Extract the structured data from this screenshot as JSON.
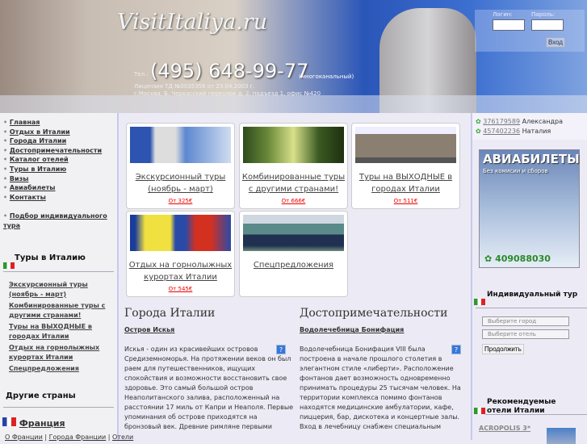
{
  "header": {
    "logo": "VisitItaliya.ru",
    "tel_label": "Тел.:",
    "phone": "(495) 648-99-77",
    "phone_note": "(многоканальный)",
    "license": "Лицензия ТД №0035356 от 23.04.2003 г.",
    "address": "г.Москва, Б. Черкасский переулок д. 2, подъезд 1, офис №420",
    "login_label": "Логин:",
    "password_label": "Пароль:",
    "login_button": "Вход"
  },
  "nav": [
    "Главная",
    "Отдых в Италии",
    "Города Италии",
    "Достопримечательности",
    "Каталог отелей",
    "Туры в Италию",
    "Визы",
    "Авиабилеты",
    "Контакты"
  ],
  "nav_extra": "Подбор индивидуального тура",
  "left": {
    "tours_title": "Туры в Италию",
    "tours": [
      "Экскурсионный туры (ноябрь - март)",
      "Комбинированные туры с другими странами!",
      "Туры на ВЫХОДНЫЕ в городах Италии",
      "Отдых на горнолыжных курортах Италии",
      "Спецпредложения"
    ],
    "other_title": "Другие страны",
    "france": "Франция",
    "france_links": [
      "О Франции",
      "Города Франции",
      "Отели"
    ]
  },
  "cards": [
    {
      "title": "Экскурсионный туры (ноябрь - март)",
      "price": "От 325€"
    },
    {
      "title": "Комбинированные туры с другими странами!",
      "price": "От 666€"
    },
    {
      "title": "Туры на ВЫХОДНЫЕ в городах Италии",
      "price": "От 511€"
    },
    {
      "title": "Отдых на горнолыжных курортах Италии",
      "price": "От 545€"
    },
    {
      "title": "Спецпредложения"
    }
  ],
  "cities": {
    "title": "Города Италии",
    "subtitle": "Остров Искья",
    "text": "Искья - один из красивейших островов Средиземноморья. На протяжении веков он был раем для путешественников, ищущих спокойствия и возможности восстановить свое здоровье. Это самый большой остров Неаполитанского залива, расположенный на расстоянии 17 миль от Капри и Неаполя. Первые упоминания об острове приходятся на бронзовый век. Древние римляне первыми"
  },
  "sights": {
    "title": "Достопримечательности",
    "subtitle": "Водолечебница Бонифация",
    "text": "Водолечебница Бонифация VIII была построена в начале прошлого столетия в элегантном стиле «либерти». Расположение фонтанов дает возможность одновременно принимать процедуры 25 тысячам человек. На территории комплекса помимо фонтанов находятся медицинские амбулатории, кафе, пиццерия, бар, дискотека и концертные залы. Вход в лечебницу снабжен специальным"
  },
  "right": {
    "icq": [
      {
        "num": "376179589",
        "name": "Александра"
      },
      {
        "num": "457402236",
        "name": "Наталия"
      }
    ],
    "avia_title": "АВИАБИЛЕТЫ",
    "avia_sub": "Без комисии и сборов",
    "avia_icq": "409088030",
    "indiv_title": "Индивидуальный тур",
    "city_select": "Выберите город",
    "hotel_select": "Выберите отель",
    "continue": "Продолжить",
    "rec_title": "Рекомендуемые отели Италии",
    "hotel": "ACROPOLIS 3*"
  }
}
